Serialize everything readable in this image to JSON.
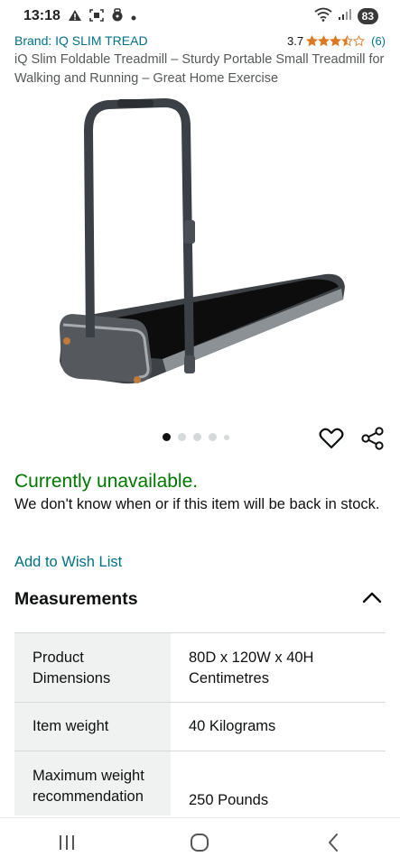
{
  "status_bar": {
    "time": "13:18",
    "battery": "83",
    "icons": [
      "warning-icon",
      "screenshot-icon",
      "lock-icon",
      "dot-icon",
      "wifi-icon",
      "signal-icon"
    ]
  },
  "product": {
    "brand_link": "Brand: IQ SLIM TREAD",
    "rating_value": "3.7",
    "rating_stars": 3.5,
    "review_count": "(6)",
    "title": "iQ Slim Foldable Treadmill – Sturdy Portable Small Treadmill for Walking and Running – Great Home Exercise",
    "image_count": 5,
    "active_image": 0
  },
  "availability": {
    "status": "Currently unavailable.",
    "note": "We don't know when or if this item will be back in stock."
  },
  "actions": {
    "add_wishlist": "Add to Wish List"
  },
  "measurements": {
    "title": "Measurements",
    "rows": [
      {
        "key": "Product Dimensions",
        "value": "80D x 120W x 40H Centimetres"
      },
      {
        "key": "Item weight",
        "value": "40 Kilograms"
      },
      {
        "key": "Maximum weight recommendation",
        "value": "250 Pounds"
      }
    ]
  },
  "colors": {
    "link": "#007185",
    "available_green": "#007600",
    "star": "#de7921",
    "table_key_bg": "#f0f2f2"
  }
}
